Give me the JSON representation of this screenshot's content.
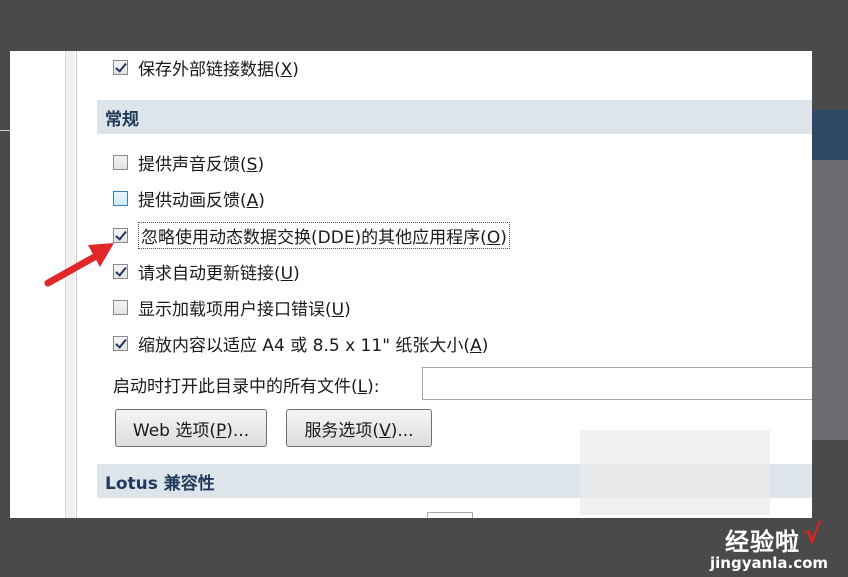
{
  "options_top": {
    "save_external_links": {
      "label_pre": "保存外部链接数据(",
      "key": "X",
      "label_post": ")",
      "checked": true
    }
  },
  "general": {
    "header": "常规",
    "items": [
      {
        "label_pre": "提供声音反馈(",
        "key": "S",
        "label_post": ")",
        "checked": false
      },
      {
        "label_pre": "提供动画反馈(",
        "key": "A",
        "label_post": ")",
        "checked": false
      },
      {
        "label_pre": "忽略使用动态数据交换(DDE)的其他应用程序(",
        "key": "O",
        "label_post": ")",
        "checked": true
      },
      {
        "label_pre": "请求自动更新链接(",
        "key": "U",
        "label_post": ")",
        "checked": true
      },
      {
        "label_pre": "显示加载项用户接口错误(",
        "key": "U",
        "label_post": ")",
        "checked": false
      },
      {
        "label_pre": "缩放内容以适应 A4 或 8.5 x 11\" 纸张大小(",
        "key": "A",
        "label_post": ")",
        "checked": true
      }
    ],
    "startup_folder": {
      "label_pre": "启动时打开此目录中的所有文件(",
      "key": "L",
      "label_post": "):",
      "value": ""
    },
    "web_options_button": {
      "label_pre": "Web 选项(",
      "key": "P",
      "label_post": ")..."
    },
    "service_options_button": {
      "label_pre": "服务选项(",
      "key": "V",
      "label_post": ")..."
    }
  },
  "lotus": {
    "header": "Lotus 兼容性"
  },
  "watermark": {
    "text": "经验啦",
    "check": "√",
    "url": "jingyanla.com"
  },
  "colors": {
    "annotation_arrow": "#e0282a",
    "section_header_bg": "#dde4ea"
  }
}
